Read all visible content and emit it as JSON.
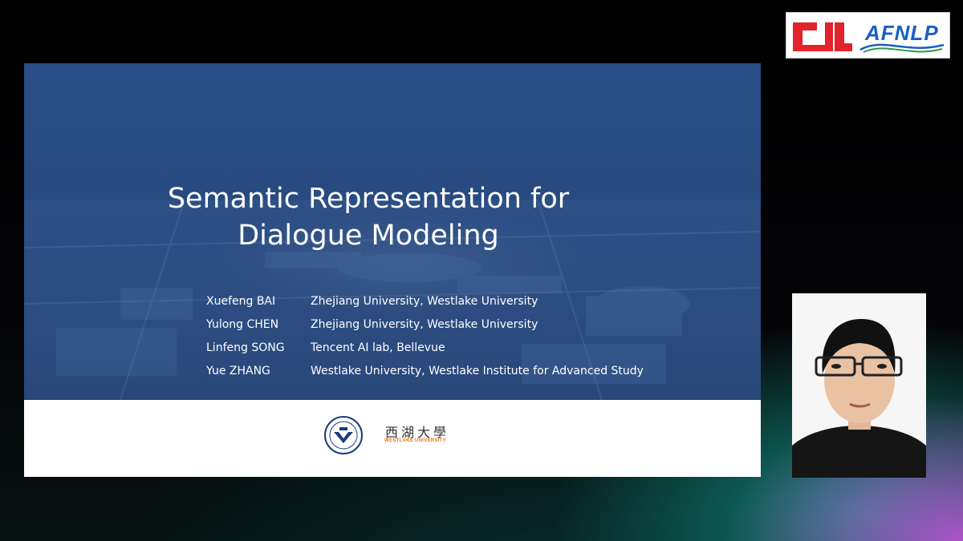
{
  "conference_logo": {
    "icon": "cl-red-logo",
    "text": "AFNLP",
    "colors": {
      "cl_red": "#e3222b",
      "afnlp_blue": "#1a5fc2",
      "afnlp_red": "#d42a2a",
      "afnlp_green": "#2a9a4a"
    }
  },
  "slide": {
    "title_line1": "Semantic Representation for",
    "title_line2": "Dialogue Modeling",
    "authors": [
      {
        "name": "Xuefeng BAI",
        "affiliation": "Zhejiang University, Westlake University"
      },
      {
        "name": "Yulong CHEN",
        "affiliation": "Zhejiang University, Westlake University"
      },
      {
        "name": "Linfeng SONG",
        "affiliation": "Tencent AI lab, Bellevue"
      },
      {
        "name": "Yue ZHANG",
        "affiliation": "Westlake University, Westlake Institute for Advanced Study"
      }
    ],
    "logos": {
      "zju_icon": "zju-seal-icon",
      "westlake_cn": "西湖大學",
      "westlake_en": "WESTLAKE UNIVERSITY"
    },
    "colors": {
      "banner_blue": "#27467a",
      "westlake_orange": "#e07a12"
    }
  },
  "speaker": {
    "icon": "speaker-video-feed"
  }
}
